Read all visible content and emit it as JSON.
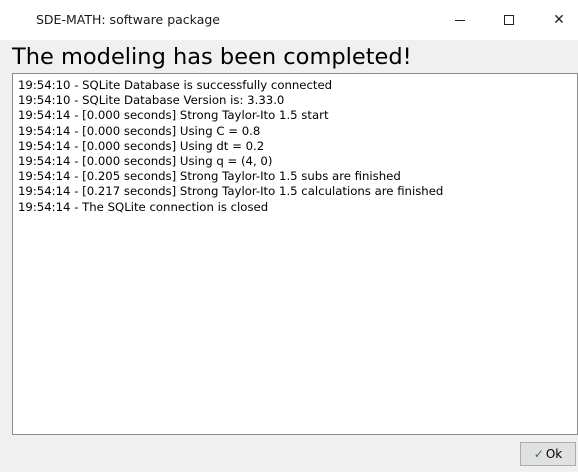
{
  "window": {
    "title": "SDE-MATH: software package",
    "minimize_glyph": "minimize-icon",
    "maximize_glyph": "maximize-icon",
    "close_label": "✕"
  },
  "heading": "The modeling has been completed!",
  "log": [
    "19:54:10 - SQLite Database is successfully connected",
    "19:54:10 - SQLite Database Version is: 3.33.0",
    "19:54:14 - [0.000 seconds] Strong Taylor-Ito 1.5 start",
    "19:54:14 - [0.000 seconds] Using C = 0.8",
    "19:54:14 - [0.000 seconds] Using dt = 0.2",
    "19:54:14 - [0.000 seconds] Using q = (4, 0)",
    "19:54:14 - [0.205 seconds] Strong Taylor-Ito 1.5 subs are finished",
    "19:54:14 - [0.217 seconds] Strong Taylor-Ito 1.5 calculations are finished",
    "19:54:14 - The SQLite connection is closed"
  ],
  "ok_button": {
    "icon": "check-icon",
    "check_glyph": "✓",
    "label": "Ok",
    "icon_color": "#2e7d32"
  }
}
